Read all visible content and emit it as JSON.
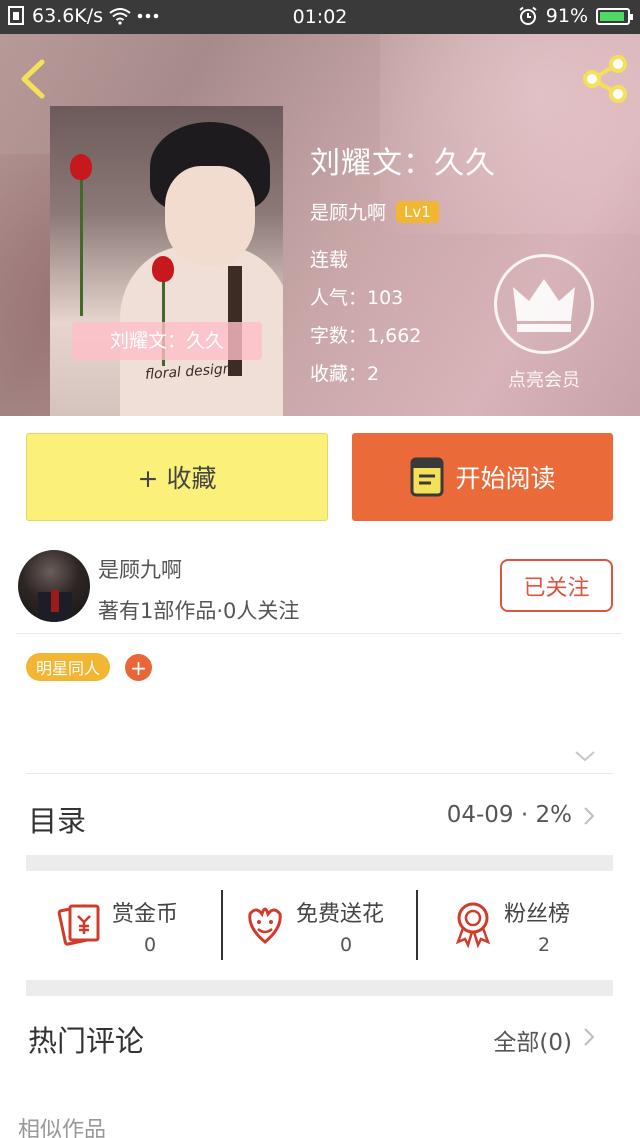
{
  "status_bar": {
    "net_speed": "63.6K/s",
    "time": "01:02",
    "battery": "91%"
  },
  "book": {
    "title": "刘耀文：久久",
    "cover_banner": "刘耀文：久久",
    "cover_shirt_text": "floral design",
    "author": "是顾九啊",
    "level": "Lv1",
    "status": "连载",
    "popularity": "人气：103",
    "word_count": "字数：1,662",
    "favorites": "收藏：2"
  },
  "vip": {
    "label": "点亮会员"
  },
  "actions": {
    "collect_label": "+ 收藏",
    "read_label": "开始阅读"
  },
  "writer": {
    "name": "是顾九啊",
    "stats": "著有1部作品·0人关注",
    "follow_label": "已关注"
  },
  "tags": [
    {
      "label": "明星同人"
    }
  ],
  "tag_add": "+",
  "catalog": {
    "title": "目录",
    "info": "04-09 · 2%"
  },
  "rewards": [
    {
      "label": "赏金币",
      "value": "0",
      "icon": "coin-envelope-icon"
    },
    {
      "label": "免费送花",
      "value": "0",
      "icon": "flower-icon"
    },
    {
      "label": "粉丝榜",
      "value": "2",
      "icon": "ribbon-medal-icon"
    }
  ],
  "comments": {
    "title": "热门评论",
    "all_label": "全部(0)"
  },
  "similar_title": "相似作品",
  "colors": {
    "accent_orange": "#ea6a39",
    "collect_yellow": "#fbf17a",
    "tag_yellow": "#f2b633",
    "follow_red": "#e0533e"
  }
}
